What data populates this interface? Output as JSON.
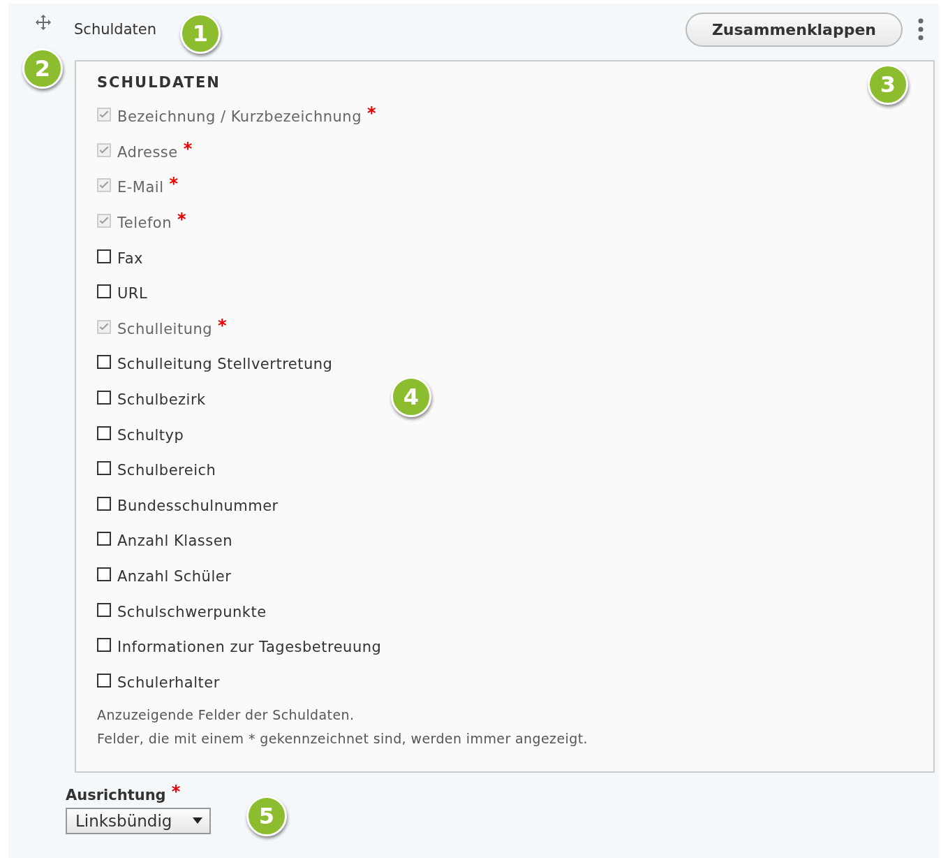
{
  "header": {
    "title": "Schuldaten",
    "collapse_button": "Zusammenklappen"
  },
  "required_mark": "*",
  "fieldset": {
    "legend": "SCHULDATEN",
    "fields": [
      {
        "label": "Bezeichnung / Kurzbezeichnung",
        "checked": true,
        "disabled": true,
        "required": true
      },
      {
        "label": "Adresse",
        "checked": true,
        "disabled": true,
        "required": true
      },
      {
        "label": "E-Mail",
        "checked": true,
        "disabled": true,
        "required": true
      },
      {
        "label": "Telefon",
        "checked": true,
        "disabled": true,
        "required": true
      },
      {
        "label": "Fax",
        "checked": false,
        "disabled": false,
        "required": false
      },
      {
        "label": "URL",
        "checked": false,
        "disabled": false,
        "required": false
      },
      {
        "label": "Schulleitung",
        "checked": true,
        "disabled": true,
        "required": true
      },
      {
        "label": "Schulleitung Stellvertretung",
        "checked": false,
        "disabled": false,
        "required": false
      },
      {
        "label": "Schulbezirk",
        "checked": false,
        "disabled": false,
        "required": false
      },
      {
        "label": "Schultyp",
        "checked": false,
        "disabled": false,
        "required": false
      },
      {
        "label": "Schulbereich",
        "checked": false,
        "disabled": false,
        "required": false
      },
      {
        "label": "Bundesschulnummer",
        "checked": false,
        "disabled": false,
        "required": false
      },
      {
        "label": "Anzahl Klassen",
        "checked": false,
        "disabled": false,
        "required": false
      },
      {
        "label": "Anzahl Schüler",
        "checked": false,
        "disabled": false,
        "required": false
      },
      {
        "label": "Schulschwerpunkte",
        "checked": false,
        "disabled": false,
        "required": false
      },
      {
        "label": "Informationen zur Tagesbetreuung",
        "checked": false,
        "disabled": false,
        "required": false
      },
      {
        "label": "Schulerhalter",
        "checked": false,
        "disabled": false,
        "required": false
      }
    ],
    "description": [
      "Anzuzeigende Felder der Schuldaten.",
      "Felder, die mit einem * gekennzeichnet sind, werden immer angezeigt."
    ]
  },
  "alignment": {
    "label": "Ausrichtung",
    "required": true,
    "value": "Linksbündig"
  },
  "callouts": [
    "1",
    "2",
    "3",
    "4",
    "5"
  ]
}
